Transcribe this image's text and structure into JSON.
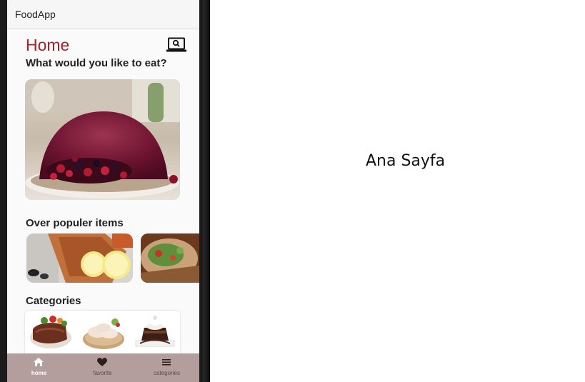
{
  "app": {
    "title": "FoodApp"
  },
  "header": {
    "title": "Home",
    "subtitle": "What would you like to eat?",
    "search_icon": "laptop-search-icon"
  },
  "hero": {
    "image": "berry-summer-pudding"
  },
  "popular": {
    "title": "Over populer items",
    "items": [
      {
        "image": "grilled-fish-with-lemon"
      },
      {
        "image": "salad-wrap"
      }
    ]
  },
  "categories": {
    "title": "Categories",
    "items": [
      {
        "image": "steak-plate"
      },
      {
        "image": "chicken-board"
      },
      {
        "image": "chocolate-cake"
      }
    ]
  },
  "bottom_nav": {
    "items": [
      {
        "label": "home",
        "icon": "home-icon",
        "active": true
      },
      {
        "label": "favorite",
        "icon": "heart-icon",
        "active": false
      },
      {
        "label": "categories",
        "icon": "menu-icon",
        "active": false
      }
    ]
  },
  "caption": "Ana Sayfa",
  "colors": {
    "accent": "#a3212a",
    "nav_bg": "#b49d9d"
  }
}
